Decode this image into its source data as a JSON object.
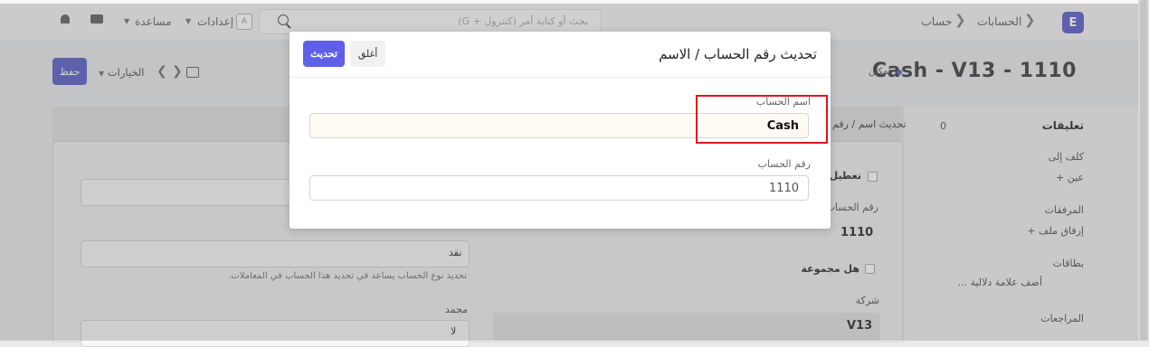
{
  "navbar": {
    "app_icon_letter": "E",
    "breadcrumbs": [
      "الحسابات",
      "حساب"
    ],
    "search_placeholder": "بحث أو كتابة أمر (كنترول + G)",
    "settings_label": "إعدادات",
    "help_label": "مساعدة",
    "settings_avatar": "A"
  },
  "page": {
    "title": "Cash - V13 - 1110",
    "indicator": "تمكين",
    "save_label": "حفظ",
    "actions_label": "الخيارات",
    "pager_prev": "❮",
    "pager_next": "❯"
  },
  "sidebar": {
    "comments_label": "تعليقات",
    "comments_count": "0",
    "assigned_to_label": "كلف إلى",
    "assign_action": "عين +",
    "attachments_label": "المرفقات",
    "attach_action": "إرفاق ملف +",
    "tags_label": "بطاقات",
    "add_tag_action": "أضف علامة دلالية ...",
    "reviews_label": "المراجعات"
  },
  "main": {
    "update_button": "تحديث اسم / رقم",
    "disabled_label": "تعطيل",
    "account_number_label": "رقم الحساب",
    "account_number_value": "1110",
    "is_group_label": "هل مجموعة",
    "company_label": "شركة",
    "company_value": "V13",
    "account_type_value": "نقد",
    "account_type_help": "تحديد نوع الحساب يساعد في تحديد هذا الحساب في المعاملات.",
    "frozen_label": "مجمد",
    "frozen_value": "لا"
  },
  "dialog": {
    "title": "تحديث رقم الحساب / الاسم",
    "update_label": "تحديث",
    "close_label": "أغلق",
    "account_name_label": "اسم الحساب",
    "account_name_value": "Cash",
    "account_number_label": "رقم الحساب",
    "account_number_value": "1110"
  },
  "colors": {
    "primary": "#5f5fe8",
    "highlight": "#e0161c"
  }
}
